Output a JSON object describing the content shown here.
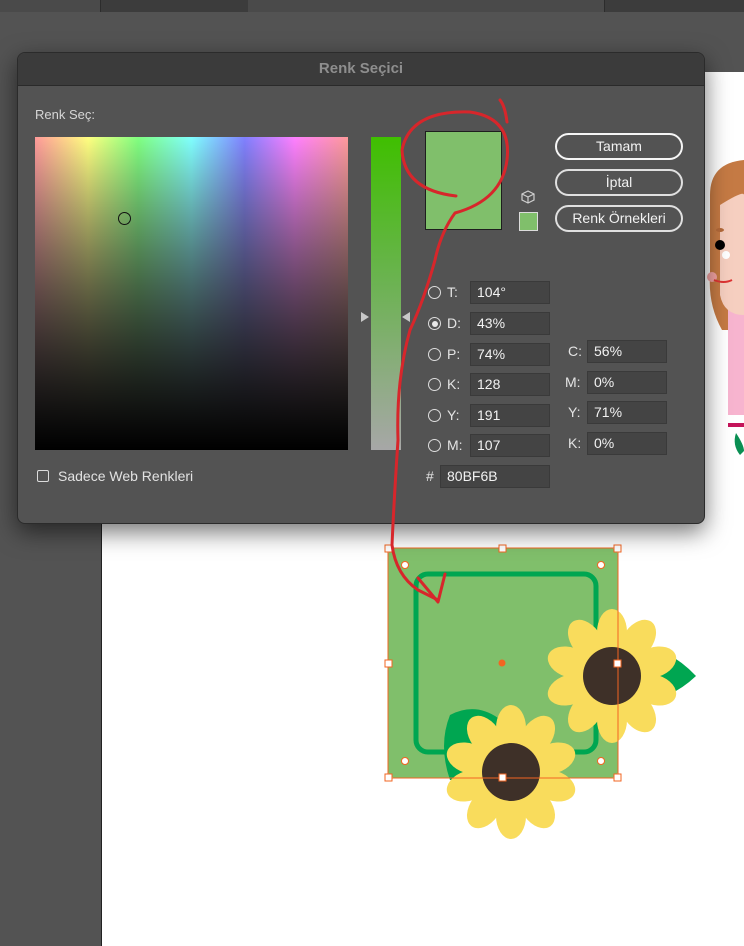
{
  "dialog": {
    "title": "Renk Seçici",
    "pick_label": "Renk Seç:",
    "current_color": "#80BF6B",
    "buttons": {
      "ok": "Tamam",
      "cancel": "İptal",
      "swatches": "Renk Örnekleri"
    },
    "web_only_label": "Sadece Web Renkleri",
    "web_only_checked": false,
    "hsb": [
      {
        "key": "hue",
        "label": "T:",
        "value": "104°",
        "checked": false
      },
      {
        "key": "saturation",
        "label": "D:",
        "value": "43%",
        "checked": true
      },
      {
        "key": "brightness",
        "label": "P:",
        "value": "74%",
        "checked": false
      }
    ],
    "rgb": [
      {
        "key": "red",
        "label": "K:",
        "value": "128",
        "checked": false
      },
      {
        "key": "green",
        "label": "Y:",
        "value": "191",
        "checked": false
      },
      {
        "key": "blue",
        "label": "M:",
        "value": "107",
        "checked": false
      }
    ],
    "hex": {
      "label": "#",
      "value": "80BF6B"
    },
    "cmyk": [
      {
        "key": "cyan",
        "label": "C:",
        "value": "56%"
      },
      {
        "key": "magenta",
        "label": "M:",
        "value": "0%"
      },
      {
        "key": "yellow",
        "label": "Y:",
        "value": "71%"
      },
      {
        "key": "black",
        "label": "K:",
        "value": "0%"
      }
    ]
  },
  "colors": {
    "selected_fill": "#80BF6B",
    "frame_green": "#00A651",
    "petal_yellow": "#F9DC5C",
    "center_brown": "#3E3028",
    "selection_orange": "#F26522",
    "annotation_red": "#D7262B"
  }
}
